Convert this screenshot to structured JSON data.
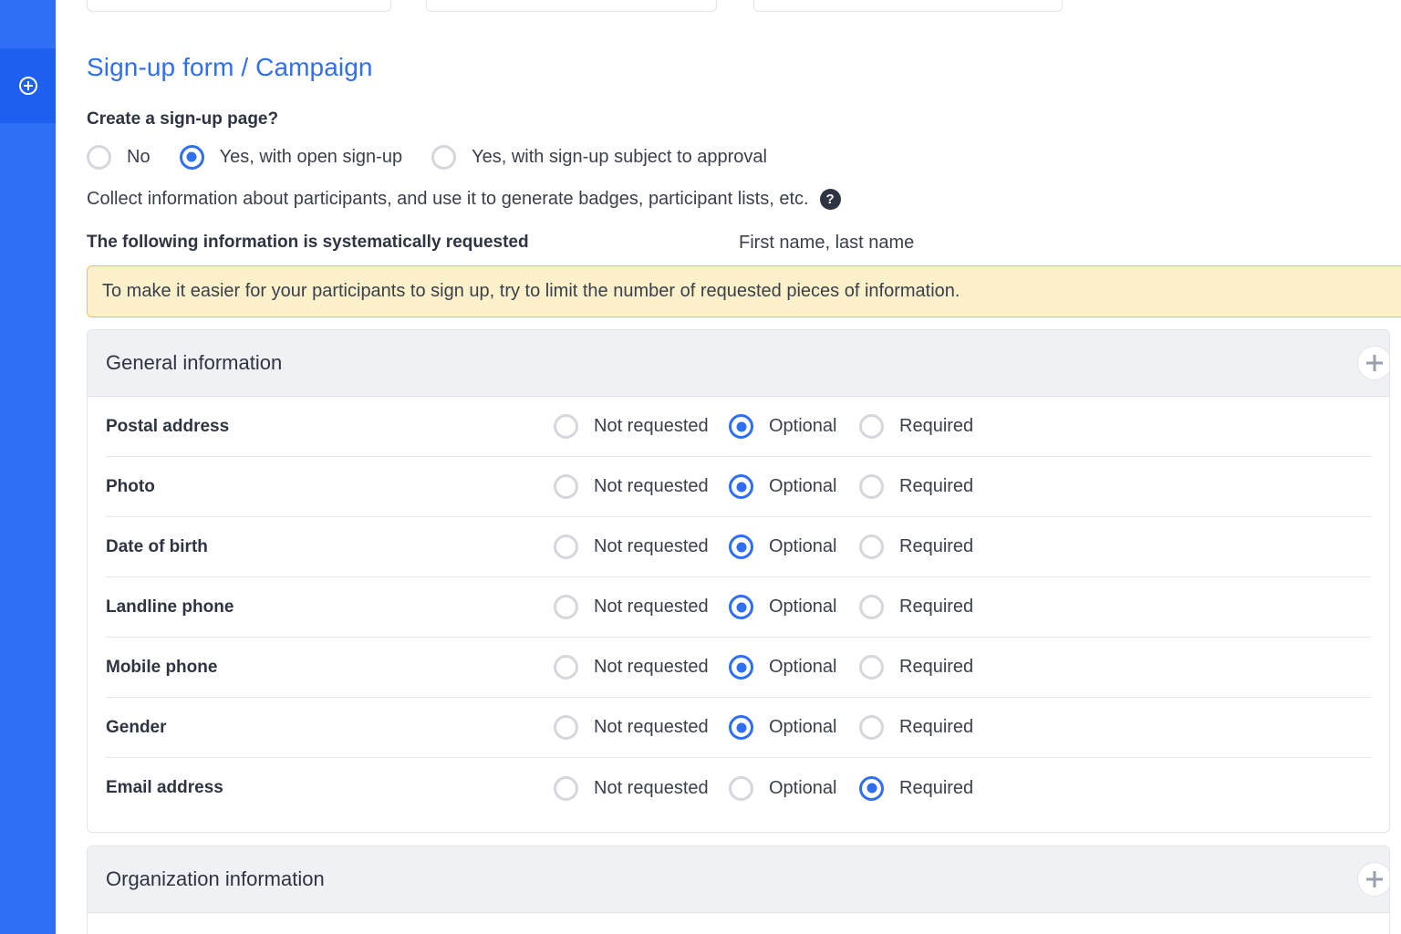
{
  "page": {
    "title": "Sign-up form / Campaign"
  },
  "signup": {
    "question": "Create a sign-up page?",
    "options": [
      {
        "label": "No",
        "checked": false
      },
      {
        "label": "Yes, with open sign-up",
        "checked": true
      },
      {
        "label": "Yes, with sign-up subject to approval",
        "checked": false
      }
    ]
  },
  "collect_text": "Collect information about participants, and use it to generate badges, participant lists, etc.",
  "help_icon": "?",
  "systematic": {
    "label": "The following information is systematically requested",
    "value": "First name, last name"
  },
  "warning": "To make it easier for your participants to sign up, try to limit the number of requested pieces of information.",
  "general": {
    "title": "General information",
    "option_labels": [
      "Not requested",
      "Optional",
      "Required"
    ],
    "fields": [
      {
        "name": "Postal address",
        "selected": "Optional"
      },
      {
        "name": "Photo",
        "selected": "Optional"
      },
      {
        "name": "Date of birth",
        "selected": "Optional"
      },
      {
        "name": "Landline phone",
        "selected": "Optional"
      },
      {
        "name": "Mobile phone",
        "selected": "Optional"
      },
      {
        "name": "Gender",
        "selected": "Optional"
      },
      {
        "name": "Email address",
        "selected": "Required"
      }
    ]
  },
  "organization": {
    "title": "Organization information"
  },
  "colors": {
    "accent": "#2f6ef5",
    "warning_bg": "#fdf1cc",
    "warning_border": "#f0c44a"
  }
}
